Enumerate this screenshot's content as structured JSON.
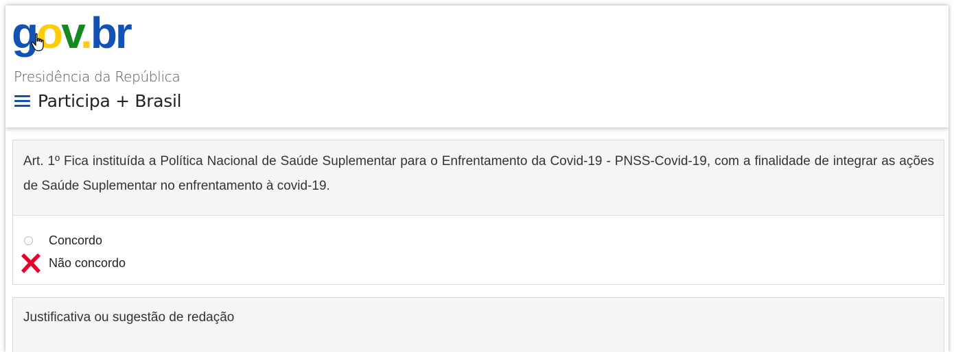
{
  "header": {
    "logo": {
      "g": "g",
      "o": "o",
      "v": "v",
      "dot": ".",
      "br": "br",
      "colors": {
        "blue": "#1351b4",
        "yellow": "#ffcd07",
        "green": "#168821"
      }
    },
    "organization": "Presidência da República",
    "menu_icon": "hamburger-menu-icon",
    "site_title": "Participa + Brasil"
  },
  "article": {
    "text": "Art. 1º  Fica instituída a Política Nacional de Saúde Suplementar para o Enfrentamento da Covid-19 - PNSS-Covid-19, com a finalidade de integrar as ações de Saúde Suplementar no enfrentamento à covid-19."
  },
  "vote": {
    "options": [
      {
        "label": "Concordo",
        "selected": false,
        "icon": "radio-empty"
      },
      {
        "label": "Não concordo",
        "selected": true,
        "icon": "red-x-icon"
      }
    ]
  },
  "justification": {
    "label": "Justificativa ou sugestão de redação"
  },
  "cursor_icon": "hand-pointer-icon"
}
